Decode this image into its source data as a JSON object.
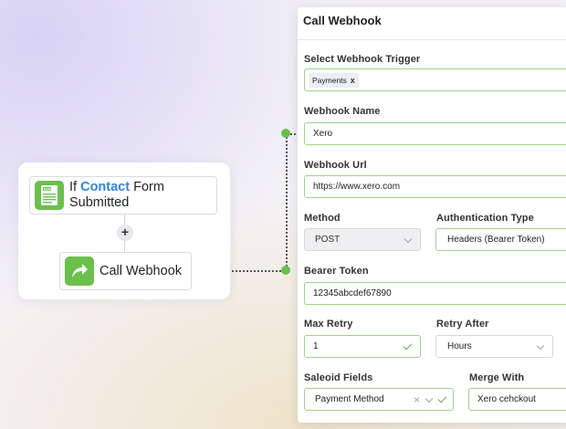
{
  "flow": {
    "trigger": {
      "prefix": "If ",
      "highlight": "Contact",
      "rest": " Form Submitted",
      "icon": "form-icon"
    },
    "add_step": "+",
    "action": {
      "title": "Call Webhook",
      "icon": "share-arrow-icon"
    }
  },
  "panel": {
    "title": "Call Webhook",
    "trigger": {
      "label": "Select Webhook Trigger",
      "chip": "Payments",
      "chip_remove": "x"
    },
    "name": {
      "label": "Webhook Name",
      "value": "Xero"
    },
    "url": {
      "label": "Webhook Url",
      "value": "https://www.xero.com"
    },
    "method": {
      "label": "Method",
      "value": "POST"
    },
    "auth": {
      "label": "Authentication Type",
      "value": "Headers (Bearer Token)"
    },
    "bearer": {
      "label": "Bearer Token",
      "value": "12345abcdef67890"
    },
    "max_retry": {
      "label": "Max Retry",
      "value": "1"
    },
    "retry_after": {
      "label": "Retry After",
      "value": "Hours"
    },
    "saleoid": {
      "label": "Saleoid Fields",
      "value": "Payment Method",
      "clear": "×"
    },
    "merge": {
      "label": "Merge With",
      "value": "Xero cehckout"
    }
  },
  "colors": {
    "accent_green": "#6ac04a",
    "link_blue": "#2f86d6",
    "field_border_green": "#9fd38a"
  }
}
